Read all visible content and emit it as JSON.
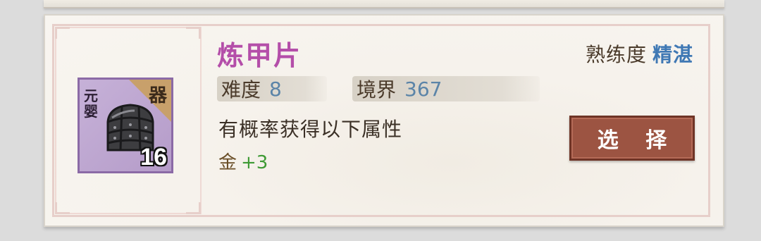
{
  "item": {
    "name": "炼甲片",
    "count": "16",
    "realm_badge": "元婴",
    "rank_badge": "器",
    "rarity_color": "#b44ea9",
    "icon": "armor-plate-icon"
  },
  "stats": {
    "difficulty_label": "难度",
    "difficulty_value": "8",
    "realm_label": "境界",
    "realm_value": "367"
  },
  "attributes": {
    "description": "有概率获得以下属性",
    "element": "金",
    "bonus": "+3"
  },
  "mastery": {
    "label": "熟练度",
    "value": "精湛"
  },
  "actions": {
    "select_label": "选 择"
  },
  "colors": {
    "button": "#9c5442",
    "stat_value": "#5b84a8",
    "bonus": "#3e9a34",
    "mastery": "#3f78b4"
  }
}
